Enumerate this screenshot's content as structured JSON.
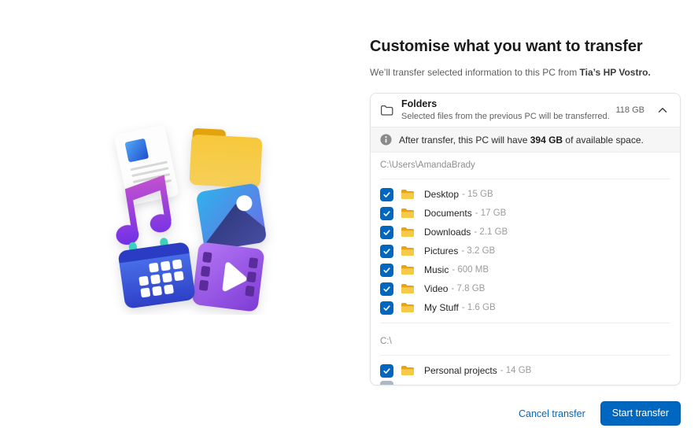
{
  "colors": {
    "accent": "#0067c0",
    "folder_yellow": "#f6c94a"
  },
  "header": {
    "title": "Customise what you want to transfer",
    "subtitle_prefix": "We’ll transfer selected information to this PC from ",
    "subtitle_bold": "Tia’s HP Vostro.",
    "subtitle_suffix": ""
  },
  "panel": {
    "category": {
      "icon": "folder-outline-icon",
      "title": "Folders",
      "description": "Selected files from the previous PC will be transferred.",
      "size": "118 GB",
      "chevron_direction": "up"
    },
    "notice": {
      "icon": "info-icon",
      "prefix": "After transfer, this PC will have ",
      "bold": "394 GB",
      "suffix": " of available space."
    },
    "size_separator": " - ",
    "sections": [
      {
        "path": "C:\\Users\\AmandaBrady",
        "items": [
          {
            "label": "Desktop",
            "size": "15 GB",
            "checked": true
          },
          {
            "label": "Documents",
            "size": "17 GB",
            "checked": true
          },
          {
            "label": "Downloads",
            "size": "2.1 GB",
            "checked": true
          },
          {
            "label": "Pictures",
            "size": "3.2 GB",
            "checked": true
          },
          {
            "label": "Music",
            "size": "600 MB",
            "checked": true
          },
          {
            "label": "Video",
            "size": "7.8 GB",
            "checked": true
          },
          {
            "label": "My Stuff",
            "size": "1.6 GB",
            "checked": true
          }
        ]
      },
      {
        "path": "C:\\",
        "items": [
          {
            "label": "Personal projects",
            "size": "14 GB",
            "checked": true
          }
        ]
      }
    ]
  },
  "footer": {
    "cancel_label": "Cancel transfer",
    "start_label": "Start transfer"
  },
  "illustration": {
    "icons": [
      "document-icon",
      "folder-icon",
      "photos-icon",
      "music-note-icon",
      "video-icon",
      "calendar-icon"
    ]
  }
}
